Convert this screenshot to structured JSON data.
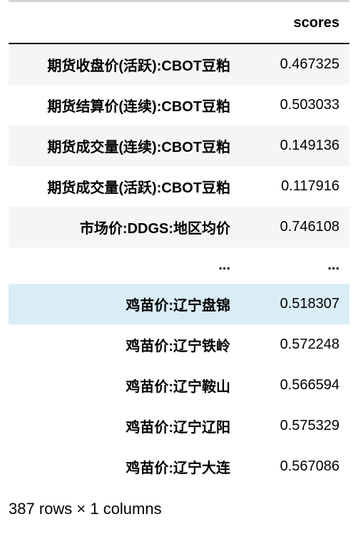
{
  "header": {
    "index_label": "",
    "value_label": "scores"
  },
  "rows": [
    {
      "index": "期货收盘价(活跃):CBOT豆粕",
      "value": "0.467325",
      "striped": true,
      "highlighted": false
    },
    {
      "index": "期货结算价(连续):CBOT豆粕",
      "value": "0.503033",
      "striped": false,
      "highlighted": false
    },
    {
      "index": "期货成交量(连续):CBOT豆粕",
      "value": "0.149136",
      "striped": true,
      "highlighted": false
    },
    {
      "index": "期货成交量(活跃):CBOT豆粕",
      "value": "0.117916",
      "striped": false,
      "highlighted": false
    },
    {
      "index": "市场价:DDGS:地区均价",
      "value": "0.746108",
      "striped": true,
      "highlighted": false
    },
    {
      "index": "...",
      "value": "...",
      "ellipsis": true
    },
    {
      "index": "鸡苗价:辽宁盘锦",
      "value": "0.518307",
      "striped": false,
      "highlighted": true
    },
    {
      "index": "鸡苗价:辽宁铁岭",
      "value": "0.572248",
      "striped": false,
      "highlighted": false
    },
    {
      "index": "鸡苗价:辽宁鞍山",
      "value": "0.566594",
      "striped": false,
      "highlighted": false
    },
    {
      "index": "鸡苗价:辽宁辽阳",
      "value": "0.575329",
      "striped": false,
      "highlighted": false
    },
    {
      "index": "鸡苗价:辽宁大连",
      "value": "0.567086",
      "striped": false,
      "highlighted": false
    }
  ],
  "footer": {
    "text": "387 rows × 1 columns"
  }
}
